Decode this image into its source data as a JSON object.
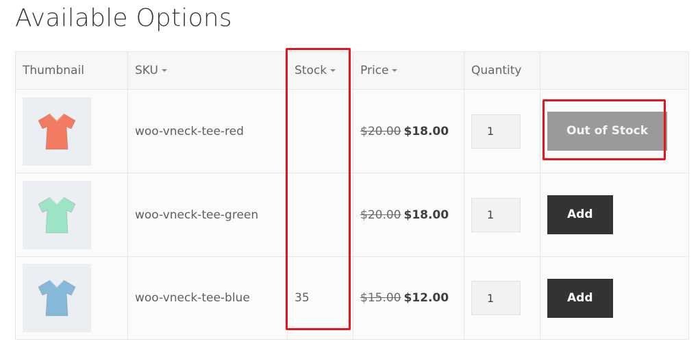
{
  "title": "Available Options",
  "columns": {
    "thumbnail": "Thumbnail",
    "sku": "SKU",
    "stock": "Stock",
    "price": "Price",
    "quantity": "Quantity",
    "action": ""
  },
  "rows": [
    {
      "color": "#f27c62",
      "sku": "woo-vneck-tee-red",
      "stock": "",
      "regular_price": "$20.00",
      "sale_price": "$18.00",
      "quantity": "1",
      "button_label": "Out of Stock",
      "button_state": "disabled"
    },
    {
      "color": "#9de3c6",
      "sku": "woo-vneck-tee-green",
      "stock": "",
      "regular_price": "$20.00",
      "sale_price": "$18.00",
      "quantity": "1",
      "button_label": "Add",
      "button_state": "enabled"
    },
    {
      "color": "#86b8d9",
      "sku": "woo-vneck-tee-blue",
      "stock": "35",
      "regular_price": "$15.00",
      "sale_price": "$12.00",
      "quantity": "1",
      "button_label": "Add",
      "button_state": "enabled"
    }
  ],
  "annotation_color": "#e8141c"
}
